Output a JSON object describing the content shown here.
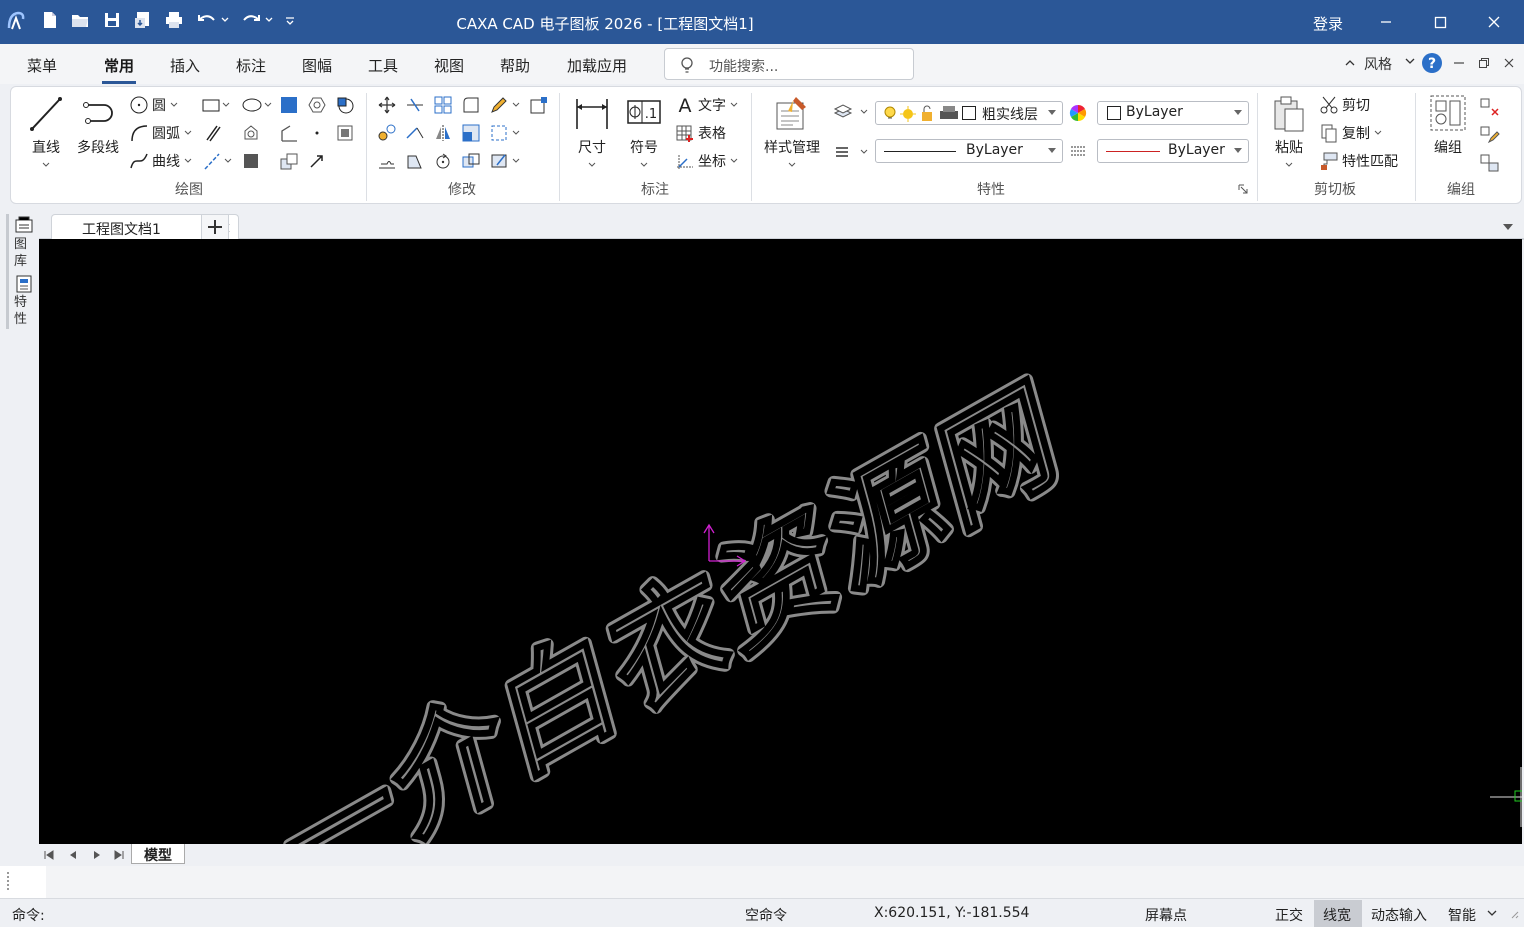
{
  "titlebar": {
    "title": "CAXA CAD 电子图板 2026 - [工程图文档1]",
    "login": "登录",
    "bg_color": "#2b5797"
  },
  "menu": {
    "tabs": [
      {
        "label": "菜单"
      },
      {
        "label": "常用",
        "active": true
      },
      {
        "label": "插入"
      },
      {
        "label": "标注"
      },
      {
        "label": "图幅"
      },
      {
        "label": "工具"
      },
      {
        "label": "视图"
      },
      {
        "label": "帮助"
      },
      {
        "label": "加载应用"
      }
    ],
    "search_placeholder": "功能搜索...",
    "style_label": "风格"
  },
  "ribbon": {
    "draw": {
      "label": "绘图",
      "line": "直线",
      "polyline": "多段线",
      "circle": "圆",
      "arc": "圆弧",
      "curve": "曲线"
    },
    "modify": {
      "label": "修改"
    },
    "annotate": {
      "label": "标注",
      "dimension": "尺寸",
      "symbol": "符号",
      "text": "文字",
      "table": "表格",
      "coordinate": "坐标"
    },
    "properties": {
      "label": "特性",
      "style_manager": "样式管理",
      "layer": "粗实线层",
      "color": "ByLayer",
      "linetype": "ByLayer",
      "linewidth": "ByLayer"
    },
    "clipboard": {
      "label": "剪切板",
      "paste": "粘贴",
      "cut": "剪切",
      "copy": "复制",
      "match": "特性匹配"
    },
    "group": {
      "label": "编组",
      "group_btn": "编组"
    }
  },
  "left_panel": {
    "library": "图库",
    "properties": "特性"
  },
  "document": {
    "tab": "工程图文档1",
    "layout_tab": "模型"
  },
  "watermark": "一介白衣资源网",
  "status": {
    "command_prompt": "命令:",
    "command_state": "空命令",
    "coords": "X:620.151, Y:-181.554",
    "snap": "屏幕点",
    "ortho": "正交",
    "lineweight": "线宽",
    "dynamic_input": "动态输入",
    "smart": "智能"
  }
}
